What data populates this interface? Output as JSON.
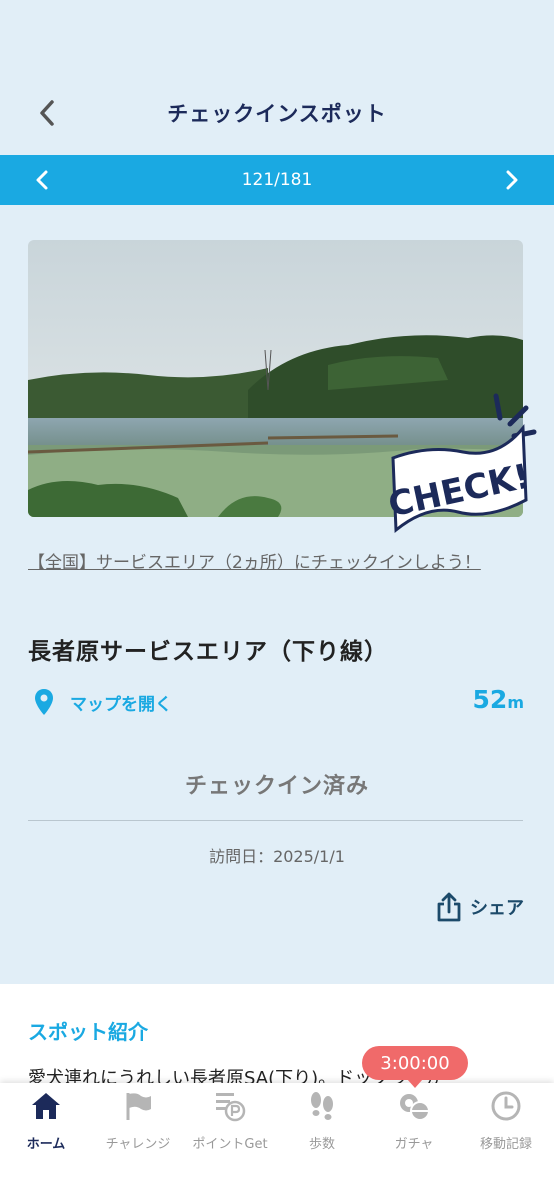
{
  "header": {
    "title": "チェックインスポット"
  },
  "pager": {
    "count": "121/181"
  },
  "badge": {
    "text": "CHECK!"
  },
  "campaign": {
    "text": "【全国】サービスエリア（2ヵ所）にチェックインしよう！"
  },
  "spot": {
    "name": "長者原サービスエリア（下り線）",
    "map_label": "マップを開く",
    "distance_value": "52",
    "distance_unit": "m"
  },
  "checkin": {
    "status": "チェックイン済み",
    "visit_date": "訪問日：2025/1/1"
  },
  "share": {
    "label": "シェア"
  },
  "intro": {
    "heading": "スポット紹介",
    "body": "愛犬連れにうれしい長者原SA(下り)。ドッグランが"
  },
  "timer": "3:00:00",
  "tabs": [
    {
      "label": "ホーム",
      "icon": "home-icon",
      "active": true
    },
    {
      "label": "チャレンジ",
      "icon": "flag-icon"
    },
    {
      "label": "ポイントGet",
      "icon": "point-icon"
    },
    {
      "label": "歩数",
      "icon": "footsteps-icon"
    },
    {
      "label": "ガチャ",
      "icon": "gacha-icon"
    },
    {
      "label": "移動記録",
      "icon": "clock-icon"
    }
  ],
  "colors": {
    "accent": "#1aa9e2",
    "navy": "#1c2a5a",
    "background": "#e1eef7",
    "timer": "#f06a6a"
  }
}
